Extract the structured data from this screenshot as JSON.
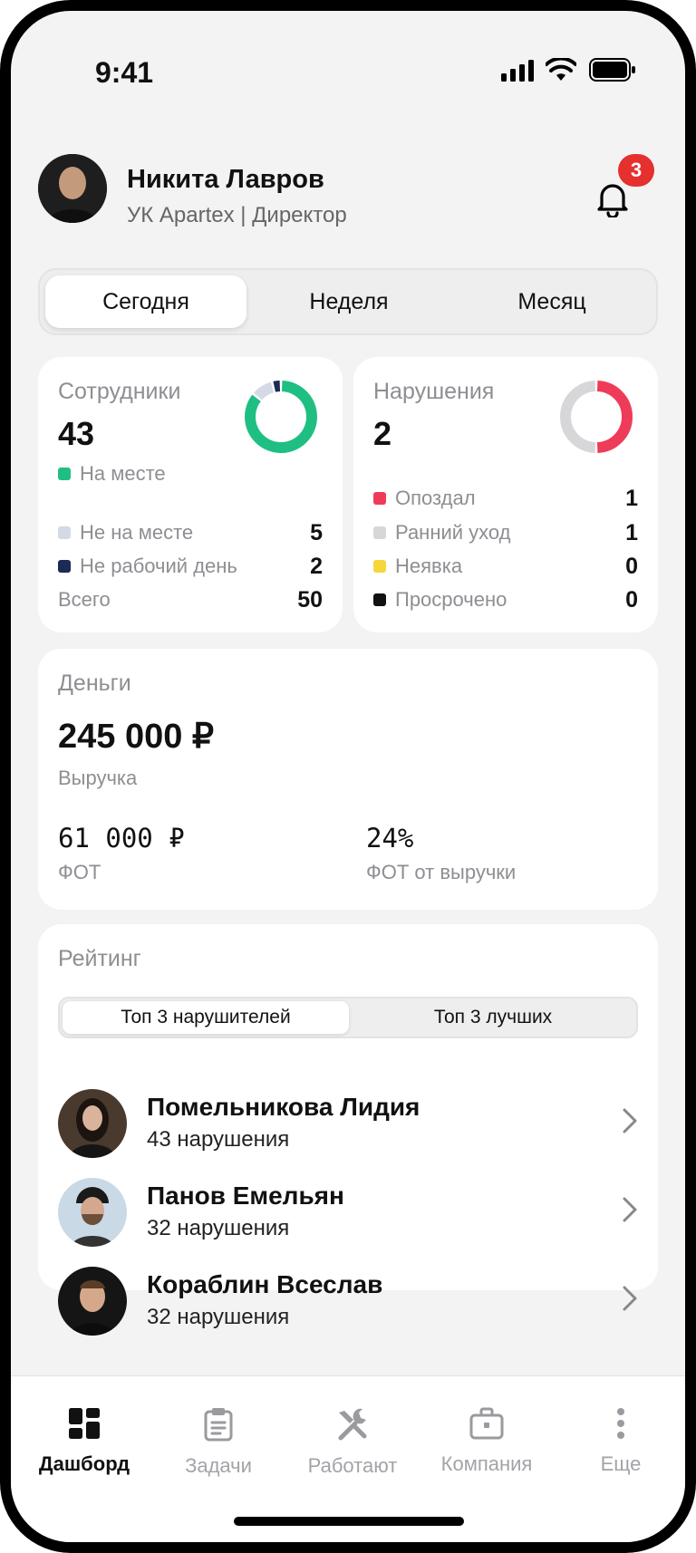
{
  "status_bar": {
    "time": "9:41"
  },
  "user": {
    "name": "Никита Лавров",
    "subtitle": "УК Apartex | Директор",
    "notification_count": "3"
  },
  "period_tabs": [
    "Сегодня",
    "Неделя",
    "Месяц"
  ],
  "employees": {
    "title": "Сотрудники",
    "count": "43",
    "present_label": "На месте",
    "rows": [
      {
        "label": "Не на месте",
        "value": "5"
      },
      {
        "label": "Не рабочий день",
        "value": "2"
      },
      {
        "label": "Всего",
        "value": "50"
      }
    ],
    "donut": {
      "present": 43,
      "absent": 5,
      "day_off": 2
    },
    "colors": {
      "present": "#1fbf83",
      "absent": "#d3dae3",
      "day_off": "#1c2a55"
    }
  },
  "violations": {
    "title": "Нарушения",
    "count": "2",
    "rows": [
      {
        "label": "Опоздал",
        "value": "1",
        "color": "#ef3b5a"
      },
      {
        "label": "Ранний уход",
        "value": "1",
        "color": "#d7d7da"
      },
      {
        "label": "Неявка",
        "value": "0",
        "color": "#f7d63a"
      },
      {
        "label": "Просрочено",
        "value": "0",
        "color": "#111111"
      }
    ],
    "donut": {
      "late": 1,
      "early_leave": 1
    }
  },
  "money": {
    "title": "Деньги",
    "revenue": "245 000 ₽",
    "revenue_label": "Выручка",
    "payroll": "61 000 ₽",
    "payroll_label": "ФОТ",
    "payroll_ratio": "24%",
    "payroll_ratio_label": "ФОТ от выручки"
  },
  "rating": {
    "title": "Рейтинг",
    "tabs": [
      "Топ 3 нарушителей",
      "Топ 3 лучших"
    ],
    "people": [
      {
        "name": "Помельникова Лидия",
        "count": "43 нарушения"
      },
      {
        "name": "Панов Емельян",
        "count": "32 нарушения"
      },
      {
        "name": "Кораблин Всеслав",
        "count": "32 нарушения"
      }
    ]
  },
  "nav": [
    {
      "label": "Дашборд",
      "icon": "dashboard-icon"
    },
    {
      "label": "Задачи",
      "icon": "clipboard-icon"
    },
    {
      "label": "Работают",
      "icon": "tools-icon"
    },
    {
      "label": "Компания",
      "icon": "briefcase-icon"
    },
    {
      "label": "Еще",
      "icon": "more-icon"
    }
  ]
}
